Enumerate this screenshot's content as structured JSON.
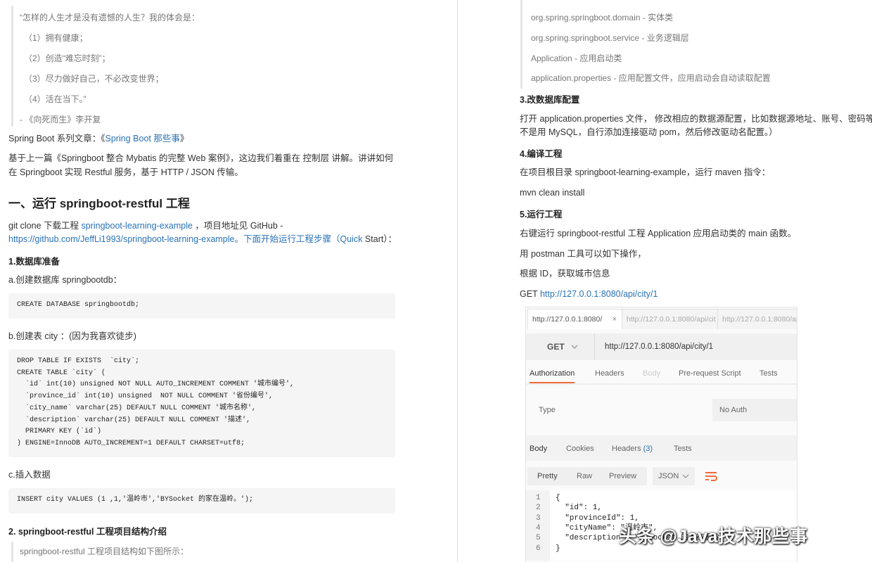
{
  "left": {
    "quote_lines": [
      "“怎样的人生才是没有遗憾的人生？我的体会是：",
      "（1）拥有健康；",
      "（2）创造“难忘时刻”；",
      "（3）尽力做好自己，不必改变世界；",
      "（4）活在当下。”",
      "- 《向死而生》李开复"
    ],
    "series_prefix": "Spring Boot 系列文章：《",
    "series_link": "Spring Boot 那些事",
    "series_suffix": "》",
    "intro_1": "基于上一篇《Springboot 整合 Mybatis 的完整 Web 案例》，这边我们着重在 控制层 讲解。讲讲如何",
    "intro_2": "在 Springboot 实现 Restful 服务，基于 HTTP / JSON 传输。",
    "heading": "一、运行 springboot-restful 工程",
    "clone_prefix": "git clone 下载工程 ",
    "clone_link": "springboot-learning-example",
    "clone_suffix": " ，项目地址见 GitHub -",
    "github_link": "https://github.com/JeffLi1993/springboot-learning-example。下面开始运行工程步骤（Quick",
    "github_suffix": " Start）：",
    "step1": "1.数据库准备",
    "step1a": "a.创建数据库 springbootdb：",
    "code1": "CREATE DATABASE springbootdb;",
    "step1b": "b.创建表 city ：(因为我喜欢徒步)",
    "code2": "DROP TABLE IF EXISTS  `city`;\nCREATE TABLE `city` (\n  `id` int(10) unsigned NOT NULL AUTO_INCREMENT COMMENT '城市编号',\n  `province_id` int(10) unsigned  NOT NULL COMMENT '省份编号',\n  `city_name` varchar(25) DEFAULT NULL COMMENT '城市名称',\n  `description` varchar(25) DEFAULT NULL COMMENT '描述',\n  PRIMARY KEY (`id`)\n) ENGINE=InnoDB AUTO_INCREMENT=1 DEFAULT CHARSET=utf8;",
    "step1c": "c.插入数据",
    "code3": "INSERT city VALUES (1 ,1,'温岭市','BYSocket 的家在温岭。');",
    "step2": "2. springboot-restful 工程项目结构介绍",
    "step2_quote": "springboot-restful 工程项目结构如下图所示："
  },
  "right": {
    "structure_lines": [
      "org.spring.springboot.domain - 实体类",
      "org.spring.springboot.service - 业务逻辑层",
      "Application - 应用启动类",
      "application.properties - 应用配置文件，应用启动会自动读取配置"
    ],
    "step3": "3.改数据库配置",
    "step3_1": "打开 application.properties 文件， 修改相应的数据源配置，比如数据源地址、账号、密码等。",
    "step3_2": "不是用 MySQL，自行添加连接驱动 pom，然后修改驱动名配置。）",
    "step4": "4.编译工程",
    "step4_1": "在项目根目录 springboot-learning-example，运行 maven 指令：",
    "step4_cmd": "mvn clean install",
    "step5": "5.运行工程",
    "step5_1": "右键运行 springboot-restful 工程 Application 应用启动类的 main 函数。",
    "step5_2": "用 postman 工具可以如下操作，",
    "step5_3": "根据 ID，获取城市信息",
    "get_prefix": "GET ",
    "get_link": "http://127.0.0.1:8080/api/city/1"
  },
  "postman": {
    "tabs": [
      "http://127.0.0.1:8080/",
      "http://127.0.0.1:8080/api/cit",
      "http://127.0.0.1:8080/api"
    ],
    "tab_close": "×",
    "method": "GET",
    "url": "http://127.0.0.1:8080/api/city/1",
    "req_tabs": [
      "Authorization",
      "Headers",
      "Body",
      "Pre-request Script",
      "Tests"
    ],
    "type_label": "Type",
    "auth_value": "No Auth",
    "resp_tabs": [
      "Body",
      "Cookies",
      "Headers",
      "(3)",
      "Tests"
    ],
    "view_btns": [
      "Pretty",
      "Raw",
      "Preview"
    ],
    "format": "JSON",
    "line_numbers": [
      "1",
      "2",
      "3",
      "4",
      "5",
      "6"
    ],
    "json_lines": [
      "{",
      "  \"id\": 1,",
      "  \"provinceId\": 1,",
      "  \"cityName\": \"温岭市\",",
      "  \"description\": \"BYSocket 的家在温岭。\"",
      "}"
    ],
    "accent": "#f26b3a"
  },
  "watermark": "头条 @Java技术那些事"
}
